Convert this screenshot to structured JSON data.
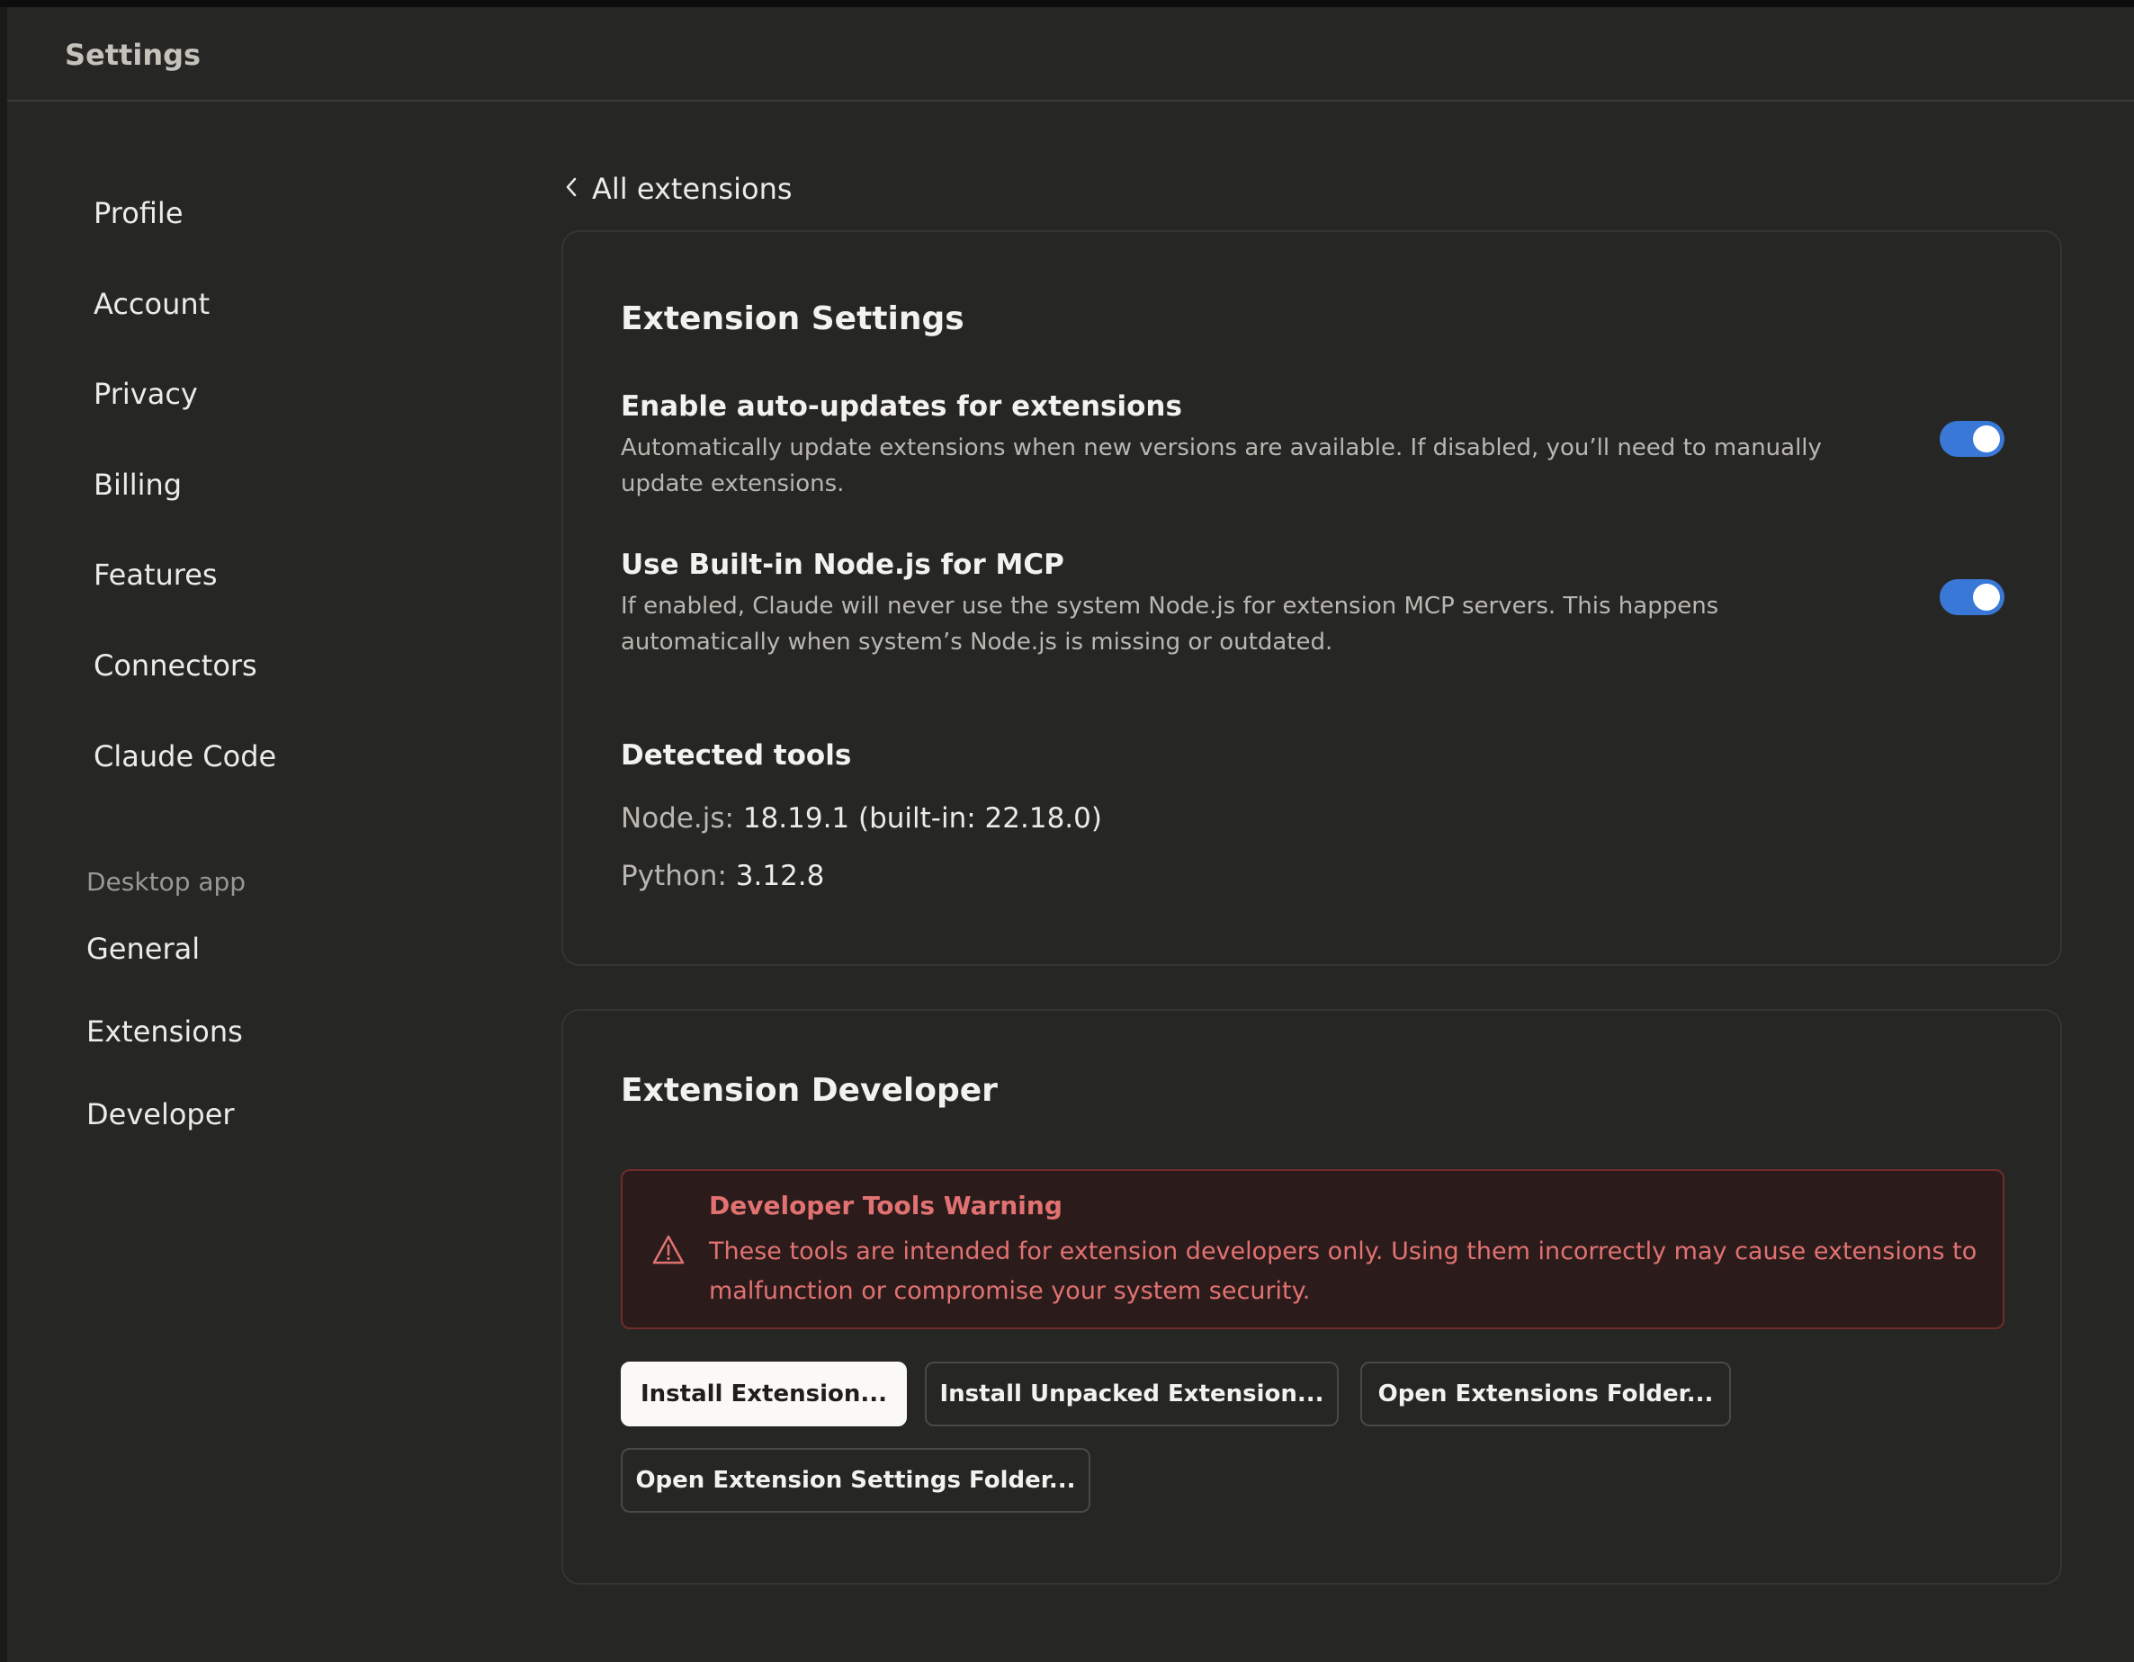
{
  "window": {
    "title": "Settings"
  },
  "sidebar": {
    "items": [
      {
        "label": "Profile"
      },
      {
        "label": "Account"
      },
      {
        "label": "Privacy"
      },
      {
        "label": "Billing"
      },
      {
        "label": "Features"
      },
      {
        "label": "Connectors"
      },
      {
        "label": "Claude Code"
      }
    ],
    "desktop_section_label": "Desktop app",
    "desktop_items": [
      {
        "label": "General"
      },
      {
        "label": "Extensions"
      },
      {
        "label": "Developer"
      }
    ]
  },
  "back_link": {
    "label": "All extensions",
    "icon": "chevron-left-icon"
  },
  "extension_settings": {
    "title": "Extension Settings",
    "auto_updates": {
      "title": "Enable auto-updates for extensions",
      "description": "Automatically update extensions when new versions are available. If disabled, you’ll need to manually update extensions.",
      "enabled": true
    },
    "builtin_node": {
      "title": "Use Built-in Node.js for MCP",
      "description": "If enabled, Claude will never use the system Node.js for extension MCP servers. This happens automatically when system’s Node.js is missing or outdated.",
      "enabled": true
    },
    "detected_tools": {
      "heading": "Detected tools",
      "node_label": "Node.js:",
      "node_value": "18.19.1 (built-in: 22.18.0)",
      "python_label": "Python:",
      "python_value": "3.12.8"
    }
  },
  "extension_developer": {
    "title": "Extension Developer",
    "warning": {
      "icon": "warning-triangle-icon",
      "title": "Developer Tools Warning",
      "body": "These tools are intended for extension developers only. Using them incorrectly may cause extensions to malfunction or compromise your system security."
    },
    "buttons": {
      "install_extension": "Install Extension...",
      "install_unpacked": "Install Unpacked Extension...",
      "open_extensions_folder": "Open Extensions Folder...",
      "open_settings_folder": "Open Extension Settings Folder..."
    }
  },
  "colors": {
    "background": "#262624",
    "toggle_on": "#3A78D8",
    "warning_text": "#E27272",
    "warning_bg": "#2B1C1B"
  }
}
